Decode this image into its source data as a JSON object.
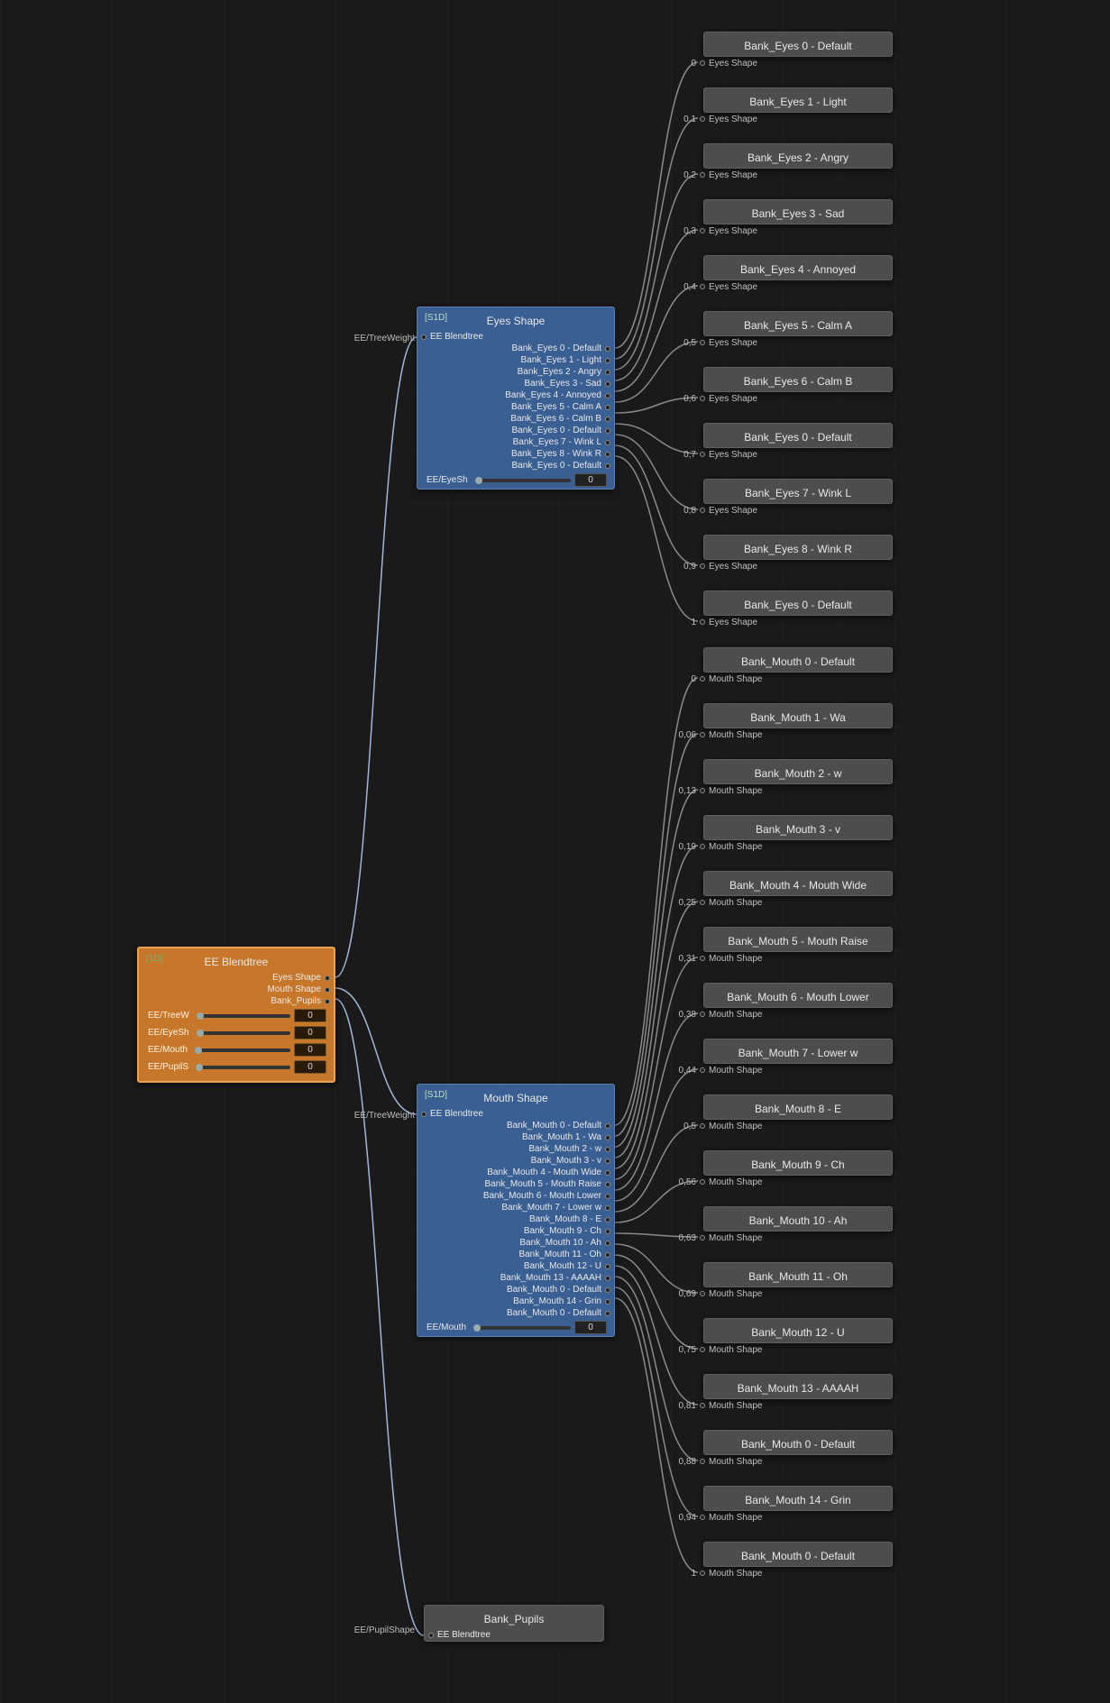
{
  "root": {
    "tag": "[1D]",
    "title": "EE Blendtree",
    "outputs": [
      "Eyes Shape",
      "Mouth Shape",
      "Bank_Pupils"
    ],
    "sliders": [
      {
        "label": "EE/TreeW",
        "value": "0"
      },
      {
        "label": "EE/EyeSh",
        "value": "0"
      },
      {
        "label": "EE/Mouth",
        "value": "0"
      },
      {
        "label": "EE/PupilS",
        "value": "0"
      }
    ]
  },
  "eyes_label": "EE/TreeWeight",
  "eyes": {
    "tag": "[S1D]",
    "title": "Eyes Shape",
    "sub": "EE Blendtree",
    "outputs": [
      "Bank_Eyes 0 - Default",
      "Bank_Eyes 1 - Light",
      "Bank_Eyes 2 - Angry",
      "Bank_Eyes 3 - Sad",
      "Bank_Eyes 4 - Annoyed",
      "Bank_Eyes 5 - Calm A",
      "Bank_Eyes 6 - Calm B",
      "Bank_Eyes 0 - Default",
      "Bank_Eyes 7 - Wink L",
      "Bank_Eyes 8 - Wink R",
      "Bank_Eyes 0 - Default"
    ],
    "slider": {
      "label": "EE/EyeSh",
      "value": "0"
    }
  },
  "eyes_leaves": [
    {
      "title": "Bank_Eyes 0 - Default",
      "thresh": "0",
      "input": "Eyes Shape"
    },
    {
      "title": "Bank_Eyes 1 - Light",
      "thresh": "0,1",
      "input": "Eyes Shape"
    },
    {
      "title": "Bank_Eyes 2 - Angry",
      "thresh": "0,2",
      "input": "Eyes Shape"
    },
    {
      "title": "Bank_Eyes 3 - Sad",
      "thresh": "0,3",
      "input": "Eyes Shape"
    },
    {
      "title": "Bank_Eyes 4 - Annoyed",
      "thresh": "0,4",
      "input": "Eyes Shape"
    },
    {
      "title": "Bank_Eyes 5 - Calm A",
      "thresh": "0,5",
      "input": "Eyes Shape"
    },
    {
      "title": "Bank_Eyes 6 - Calm B",
      "thresh": "0,6",
      "input": "Eyes Shape"
    },
    {
      "title": "Bank_Eyes 0 - Default",
      "thresh": "0,7",
      "input": "Eyes Shape"
    },
    {
      "title": "Bank_Eyes 7 - Wink L",
      "thresh": "0,8",
      "input": "Eyes Shape"
    },
    {
      "title": "Bank_Eyes 8 - Wink R",
      "thresh": "0,9",
      "input": "Eyes Shape"
    },
    {
      "title": "Bank_Eyes 0 - Default",
      "thresh": "1",
      "input": "Eyes Shape"
    }
  ],
  "mouth_label": "EE/TreeWeight",
  "mouth": {
    "tag": "[S1D]",
    "title": "Mouth Shape",
    "sub": "EE Blendtree",
    "outputs": [
      "Bank_Mouth 0 - Default",
      "Bank_Mouth 1 - Wa",
      "Bank_Mouth 2 - w",
      "Bank_Mouth 3 - v",
      "Bank_Mouth 4 - Mouth Wide",
      "Bank_Mouth 5 - Mouth Raise",
      "Bank_Mouth 6 - Mouth Lower",
      "Bank_Mouth 7 - Lower w",
      "Bank_Mouth 8 - E",
      "Bank_Mouth 9 - Ch",
      "Bank_Mouth 10 - Ah",
      "Bank_Mouth 11 - Oh",
      "Bank_Mouth 12 - U",
      "Bank_Mouth 13 - AAAAH",
      "Bank_Mouth 0 - Default",
      "Bank_Mouth 14 - Grin",
      "Bank_Mouth 0 - Default"
    ],
    "slider": {
      "label": "EE/Mouth",
      "value": "0"
    }
  },
  "mouth_leaves": [
    {
      "title": "Bank_Mouth 0 - Default",
      "thresh": "0",
      "input": "Mouth Shape"
    },
    {
      "title": "Bank_Mouth 1 - Wa",
      "thresh": "0,06",
      "input": "Mouth Shape"
    },
    {
      "title": "Bank_Mouth 2 - w",
      "thresh": "0,13",
      "input": "Mouth Shape"
    },
    {
      "title": "Bank_Mouth 3 - v",
      "thresh": "0,19",
      "input": "Mouth Shape"
    },
    {
      "title": "Bank_Mouth 4 - Mouth Wide",
      "thresh": "0,25",
      "input": "Mouth Shape"
    },
    {
      "title": "Bank_Mouth 5 - Mouth Raise",
      "thresh": "0,31",
      "input": "Mouth Shape"
    },
    {
      "title": "Bank_Mouth 6 - Mouth Lower",
      "thresh": "0,38",
      "input": "Mouth Shape"
    },
    {
      "title": "Bank_Mouth 7 - Lower w",
      "thresh": "0,44",
      "input": "Mouth Shape"
    },
    {
      "title": "Bank_Mouth 8 - E",
      "thresh": "0,5",
      "input": "Mouth Shape"
    },
    {
      "title": "Bank_Mouth 9 - Ch",
      "thresh": "0,56",
      "input": "Mouth Shape"
    },
    {
      "title": "Bank_Mouth 10 - Ah",
      "thresh": "0,63",
      "input": "Mouth Shape"
    },
    {
      "title": "Bank_Mouth 11 - Oh",
      "thresh": "0,69",
      "input": "Mouth Shape"
    },
    {
      "title": "Bank_Mouth 12 - U",
      "thresh": "0,75",
      "input": "Mouth Shape"
    },
    {
      "title": "Bank_Mouth 13 - AAAAH",
      "thresh": "0,81",
      "input": "Mouth Shape"
    },
    {
      "title": "Bank_Mouth 0 - Default",
      "thresh": "0,88",
      "input": "Mouth Shape"
    },
    {
      "title": "Bank_Mouth 14 - Grin",
      "thresh": "0,94",
      "input": "Mouth Shape"
    },
    {
      "title": "Bank_Mouth 0 - Default",
      "thresh": "1",
      "input": "Mouth Shape"
    }
  ],
  "pupils": {
    "title": "Bank_Pupils",
    "label": "EE/PupilShape",
    "input": "EE Blendtree"
  }
}
